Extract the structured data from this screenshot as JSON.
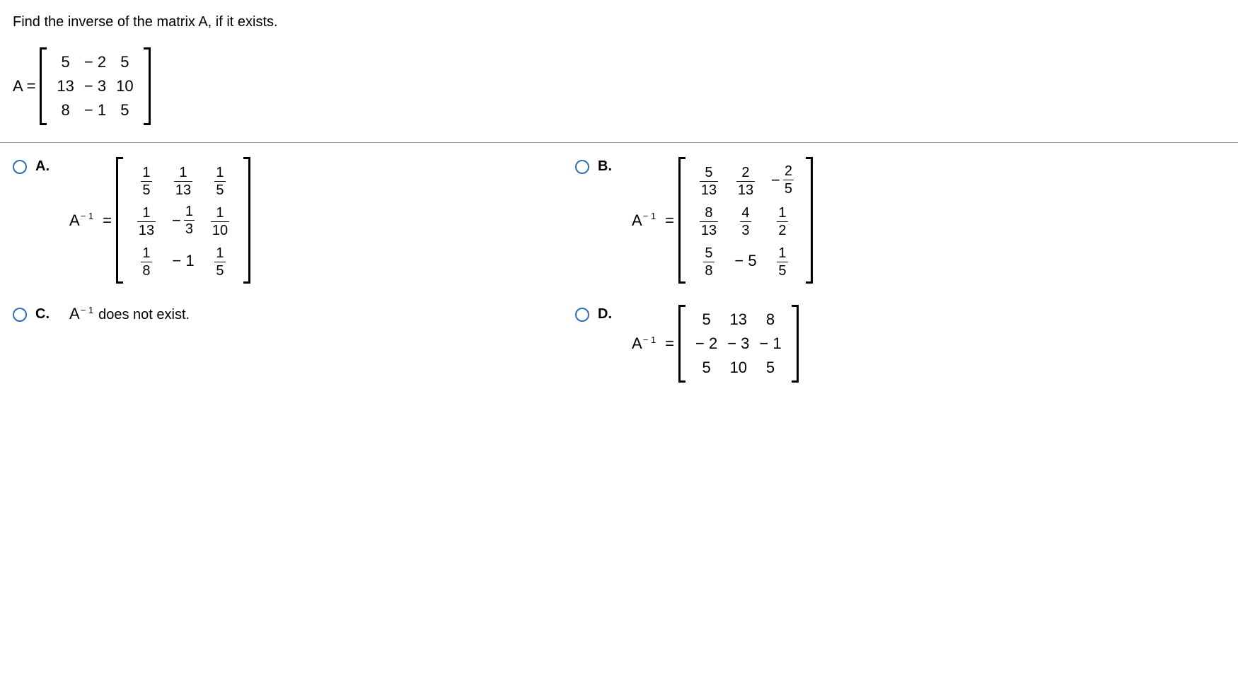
{
  "prompt": "Find the inverse of the matrix A, if it exists.",
  "given_lhs": "A =",
  "matrix_A": [
    [
      "5",
      "− 2",
      "5"
    ],
    [
      "13",
      "− 3",
      "10"
    ],
    [
      "8",
      "− 1",
      "5"
    ]
  ],
  "ainv_label": "A",
  "ainv_sup": "− 1",
  "equals": "=",
  "options": {
    "A": {
      "letter": "A.",
      "type": "matrix_frac",
      "rows": [
        [
          {
            "n": "1",
            "d": "5"
          },
          {
            "n": "1",
            "d": "13"
          },
          {
            "n": "1",
            "d": "5"
          }
        ],
        [
          {
            "n": "1",
            "d": "13"
          },
          {
            "sign": "−",
            "n": "1",
            "d": "3"
          },
          {
            "n": "1",
            "d": "10"
          }
        ],
        [
          {
            "n": "1",
            "d": "8"
          },
          {
            "int": "− 1"
          },
          {
            "n": "1",
            "d": "5"
          }
        ]
      ]
    },
    "B": {
      "letter": "B.",
      "type": "matrix_frac",
      "rows": [
        [
          {
            "n": "5",
            "d": "13"
          },
          {
            "n": "2",
            "d": "13"
          },
          {
            "sign": "−",
            "n": "2",
            "d": "5"
          }
        ],
        [
          {
            "n": "8",
            "d": "13"
          },
          {
            "n": "4",
            "d": "3"
          },
          {
            "n": "1",
            "d": "2"
          }
        ],
        [
          {
            "n": "5",
            "d": "8"
          },
          {
            "int": "− 5"
          },
          {
            "n": "1",
            "d": "5"
          }
        ]
      ]
    },
    "C": {
      "letter": "C.",
      "type": "text",
      "text": "does not exist."
    },
    "D": {
      "letter": "D.",
      "type": "matrix_int",
      "rows": [
        [
          "5",
          "13",
          "8"
        ],
        [
          "− 2",
          "− 3",
          "− 1"
        ],
        [
          "5",
          "10",
          "5"
        ]
      ]
    }
  }
}
